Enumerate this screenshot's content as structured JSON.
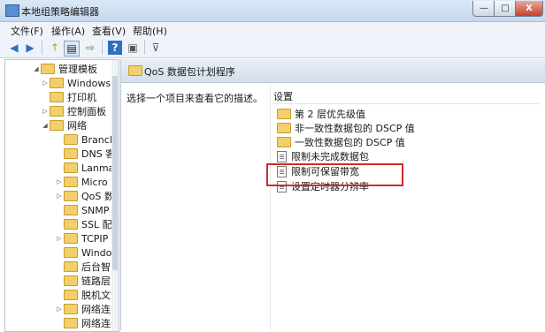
{
  "window": {
    "title": "本地组策略编辑器"
  },
  "caption_buttons": {
    "min": "—",
    "max": "□",
    "close": "X"
  },
  "menu": [
    "文件(F)",
    "操作(A)",
    "查看(V)",
    "帮助(H)"
  ],
  "toolbar": {
    "back": "◀",
    "forward": "▶",
    "up": "↑",
    "show_tree": "▤",
    "export": "⇨",
    "help": "?",
    "properties": "▣",
    "filter": "⊽"
  },
  "tree": [
    {
      "label": "管理模板",
      "toggle": "◢"
    },
    {
      "label": "Windows",
      "toggle": "▷"
    },
    {
      "label": "打印机",
      "toggle": ""
    },
    {
      "label": "控制面板",
      "toggle": "▷"
    },
    {
      "label": "网络",
      "toggle": "◢"
    },
    {
      "label": "Brancl",
      "toggle": ""
    },
    {
      "label": "DNS 客",
      "toggle": ""
    },
    {
      "label": "Lanma",
      "toggle": ""
    },
    {
      "label": "Micro",
      "toggle": "▷"
    },
    {
      "label": "QoS 数",
      "toggle": "▷"
    },
    {
      "label": "SNMP",
      "toggle": ""
    },
    {
      "label": "SSL 配",
      "toggle": ""
    },
    {
      "label": "TCPIP",
      "toggle": "▷"
    },
    {
      "label": "Windo",
      "toggle": ""
    },
    {
      "label": "后台智",
      "toggle": ""
    },
    {
      "label": "链路层",
      "toggle": ""
    },
    {
      "label": "脱机文",
      "toggle": ""
    },
    {
      "label": "网络连",
      "toggle": "▷"
    },
    {
      "label": "网络连",
      "toggle": ""
    }
  ],
  "right": {
    "header_title": "QoS 数据包计划程序",
    "description": "选择一个项目来查看它的描述。",
    "column_header": "设置",
    "settings": [
      {
        "label": "第 2 层优先级值",
        "icon": "folder-icon"
      },
      {
        "label": "非一致性数据包的 DSCP 值",
        "icon": "folder-icon"
      },
      {
        "label": "一致性数据包的 DSCP 值",
        "icon": "folder-icon"
      },
      {
        "label": "限制未完成数据包",
        "icon": "policy-icon"
      },
      {
        "label": "限制可保留带宽",
        "icon": "policy-icon"
      },
      {
        "label": "设置定时器分辨率",
        "icon": "policy-icon"
      }
    ]
  },
  "colors": {
    "highlight": "#d22a2a",
    "folder": "#f2cf6a"
  }
}
